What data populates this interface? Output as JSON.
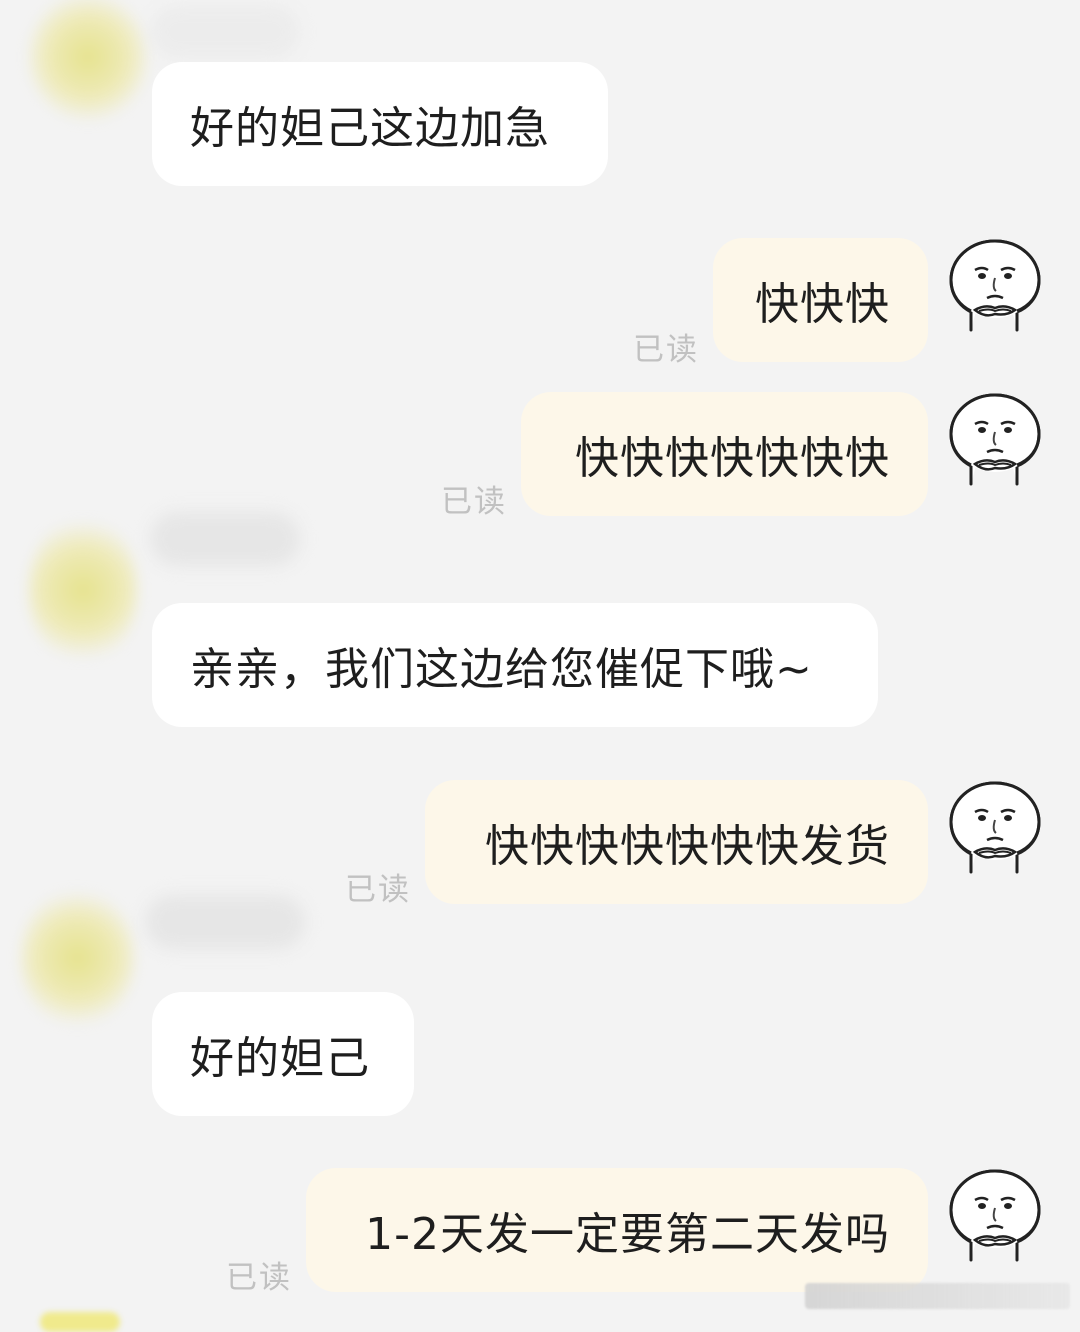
{
  "messages": {
    "m1": {
      "text": "好的妲己这边加急"
    },
    "m2": {
      "text": "快快快",
      "status": "已读"
    },
    "m3": {
      "text": "快快快快快快快",
      "status": "已读"
    },
    "m4": {
      "text": "亲亲，我们这边给您催促下哦~"
    },
    "m5": {
      "text": "快快快快快快快发货",
      "status": "已读"
    },
    "m6": {
      "text": "好的妲己"
    },
    "m7": {
      "text": "1-2天发一定要第二天发吗",
      "status": "已读"
    }
  },
  "icons": {
    "self_avatar": "meme-face-avatar-icon",
    "contact_avatar": "blurred-avatar"
  },
  "colors": {
    "background": "#f3f3f3",
    "incoming_bubble": "#ffffff",
    "outgoing_bubble": "#fdf7e9",
    "read_status": "#c1c1c1"
  }
}
